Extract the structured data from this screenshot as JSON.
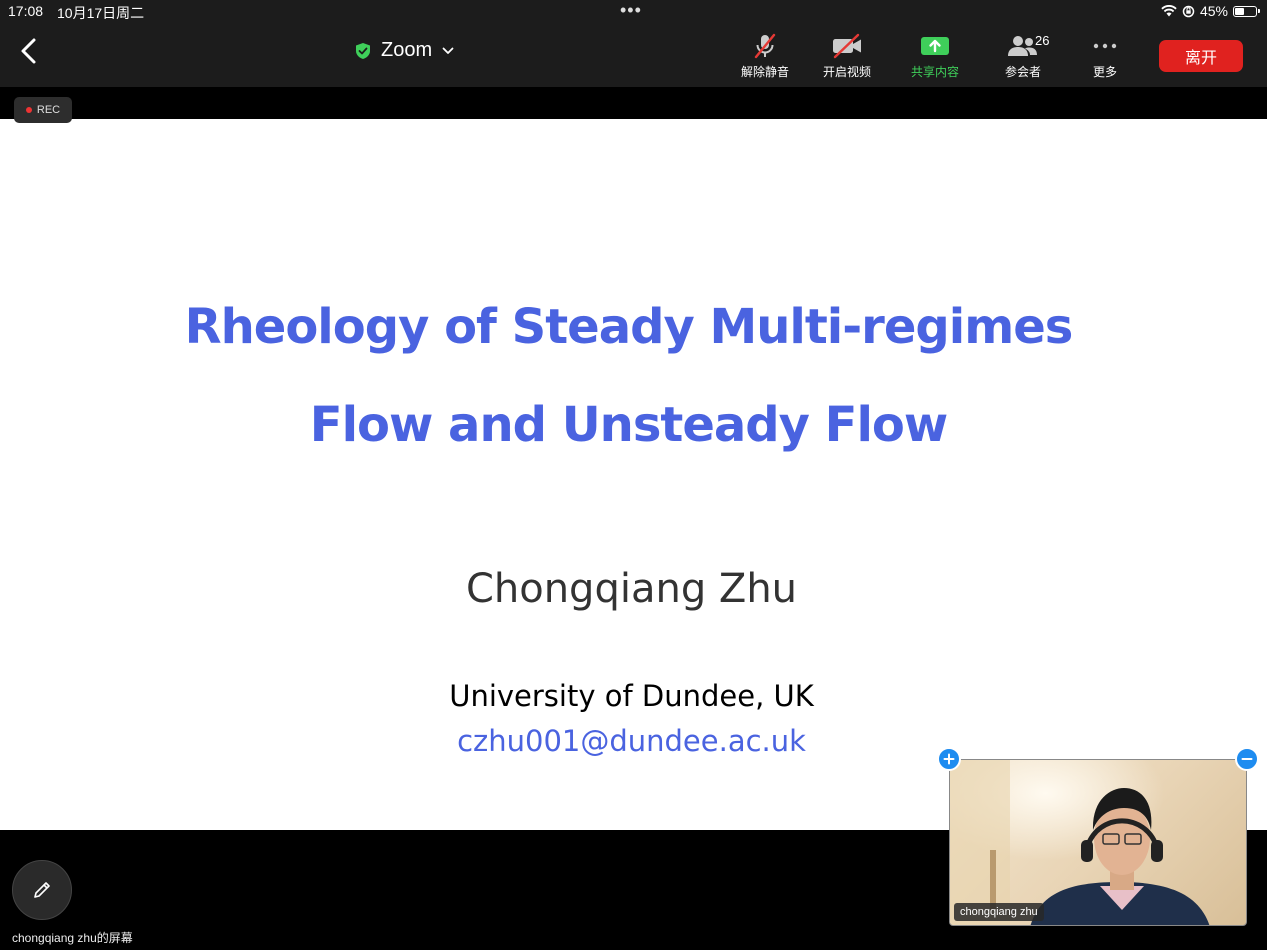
{
  "status_bar": {
    "time": "17:08",
    "date": "10月17日周二",
    "battery": "45%",
    "battery_level": 0.45
  },
  "toolbar": {
    "back_icon": "chevron-left-icon",
    "app_title": "Zoom",
    "secure_icon": "shield-check-icon",
    "mute_label": "解除静音",
    "video_label": "开启视频",
    "share_label": "共享内容",
    "participants_label": "参会者",
    "participants_count": "26",
    "more_label": "更多",
    "leave_label": "离开",
    "colors": {
      "share": "#3fcf5a",
      "leave": "#e0221f",
      "secure": "#3fcf5a"
    }
  },
  "recording": {
    "label": "REC",
    "dot_color": "#e33333"
  },
  "slide": {
    "title_line1": "Rheology of Steady Multi-regimes",
    "title_line2": "Flow and Unsteady Flow",
    "author": "Chongqiang Zhu",
    "affiliation": "University of Dundee, UK",
    "email": "czhu001@dundee.ac.uk",
    "accent_color": "#4a63e0"
  },
  "video_thumbnail": {
    "participant_name": "chongqiang zhu",
    "expand_icon": "plus-icon",
    "minimize_icon": "minus-icon"
  },
  "bottom": {
    "annotate_icon": "pencil-icon",
    "screen_owner": "chongqiang zhu的屏幕"
  }
}
